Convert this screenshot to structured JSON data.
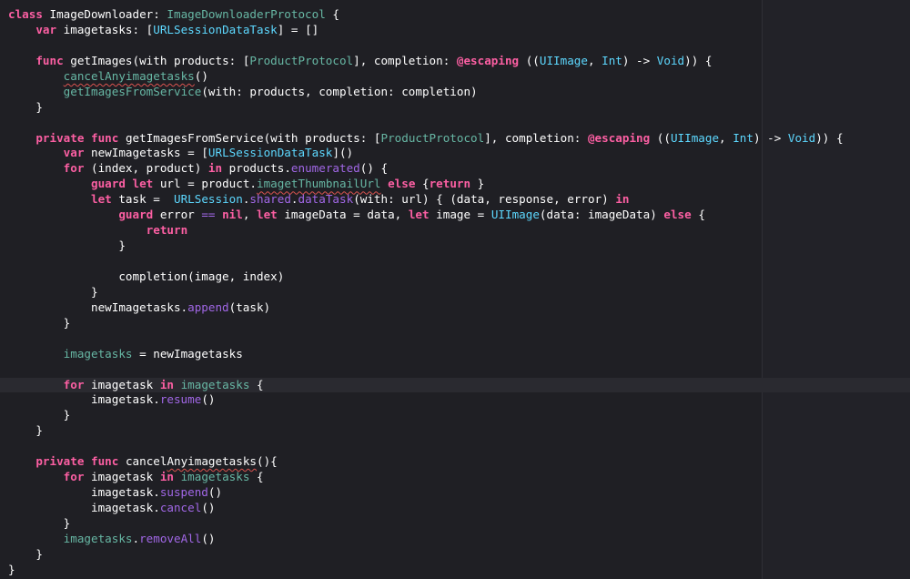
{
  "colors": {
    "background": "#1f1f24",
    "keyword": "#fc5fa3",
    "type": "#5dd8ff",
    "project_symbol": "#a167e6",
    "property": "#67b7a4",
    "plain": "#ffffff",
    "current_line": "#2a2a30"
  },
  "editor": {
    "current_line_index": 24,
    "lines": [
      {
        "tokens": [
          {
            "t": "class",
            "c": "kw"
          },
          {
            "t": " ImageDownloader: ",
            "c": "pl"
          },
          {
            "t": "ImageDownloaderProtocol",
            "c": "prm"
          },
          {
            "t": " {",
            "c": "pl"
          }
        ]
      },
      {
        "tokens": [
          {
            "t": "    ",
            "c": "pl"
          },
          {
            "t": "var",
            "c": "kw"
          },
          {
            "t": " imagetasks: [",
            "c": "pl"
          },
          {
            "t": "URLSessionDataTask",
            "c": "typ"
          },
          {
            "t": "] = []",
            "c": "pl"
          }
        ]
      },
      {
        "tokens": []
      },
      {
        "tokens": [
          {
            "t": "    ",
            "c": "pl"
          },
          {
            "t": "func",
            "c": "kw"
          },
          {
            "t": " getImages(with products: [",
            "c": "pl"
          },
          {
            "t": "ProductProtocol",
            "c": "prm"
          },
          {
            "t": "], completion: ",
            "c": "pl"
          },
          {
            "t": "@escaping",
            "c": "kw"
          },
          {
            "t": " ((",
            "c": "pl"
          },
          {
            "t": "UIImage",
            "c": "typ"
          },
          {
            "t": ", ",
            "c": "pl"
          },
          {
            "t": "Int",
            "c": "typ"
          },
          {
            "t": ") -> ",
            "c": "pl"
          },
          {
            "t": "Void",
            "c": "typ"
          },
          {
            "t": ")) {",
            "c": "pl"
          }
        ]
      },
      {
        "tokens": [
          {
            "t": "        ",
            "c": "pl"
          },
          {
            "t": "cancelAnyimagetasks",
            "c": "prm",
            "sq": true
          },
          {
            "t": "()",
            "c": "pl"
          }
        ]
      },
      {
        "tokens": [
          {
            "t": "        ",
            "c": "pl"
          },
          {
            "t": "getImagesFromService",
            "c": "prm"
          },
          {
            "t": "(with: products, completion: completion)",
            "c": "pl"
          }
        ]
      },
      {
        "tokens": [
          {
            "t": "    }",
            "c": "pl"
          }
        ]
      },
      {
        "tokens": []
      },
      {
        "tokens": [
          {
            "t": "    ",
            "c": "pl"
          },
          {
            "t": "private",
            "c": "kw"
          },
          {
            "t": " ",
            "c": "pl"
          },
          {
            "t": "func",
            "c": "kw"
          },
          {
            "t": " getImagesFromService(with products: [",
            "c": "pl"
          },
          {
            "t": "ProductProtocol",
            "c": "prm"
          },
          {
            "t": "], completion: ",
            "c": "pl"
          },
          {
            "t": "@escaping",
            "c": "kw"
          },
          {
            "t": " ((",
            "c": "pl"
          },
          {
            "t": "UIImage",
            "c": "typ"
          },
          {
            "t": ", ",
            "c": "pl"
          },
          {
            "t": "Int",
            "c": "typ"
          },
          {
            "t": ") -> ",
            "c": "pl"
          },
          {
            "t": "Void",
            "c": "typ"
          },
          {
            "t": ")) {",
            "c": "pl"
          }
        ]
      },
      {
        "tokens": [
          {
            "t": "        ",
            "c": "pl"
          },
          {
            "t": "var",
            "c": "kw"
          },
          {
            "t": " newImagetasks = [",
            "c": "pl"
          },
          {
            "t": "URLSessionDataTask",
            "c": "typ"
          },
          {
            "t": "]()",
            "c": "pl"
          }
        ]
      },
      {
        "tokens": [
          {
            "t": "        ",
            "c": "pl"
          },
          {
            "t": "for",
            "c": "kw"
          },
          {
            "t": " (index, product) ",
            "c": "pl"
          },
          {
            "t": "in",
            "c": "kw"
          },
          {
            "t": " products.",
            "c": "pl"
          },
          {
            "t": "enumerated",
            "c": "prj"
          },
          {
            "t": "() {",
            "c": "pl"
          }
        ]
      },
      {
        "tokens": [
          {
            "t": "            ",
            "c": "pl"
          },
          {
            "t": "guard",
            "c": "kw"
          },
          {
            "t": " ",
            "c": "pl"
          },
          {
            "t": "let",
            "c": "kw"
          },
          {
            "t": " url = product.",
            "c": "pl"
          },
          {
            "t": "imagetThumbnailUrl",
            "c": "prm",
            "sq": true
          },
          {
            "t": " ",
            "c": "pl"
          },
          {
            "t": "else",
            "c": "kw"
          },
          {
            "t": " {",
            "c": "pl"
          },
          {
            "t": "return",
            "c": "kw"
          },
          {
            "t": " }",
            "c": "pl"
          }
        ]
      },
      {
        "tokens": [
          {
            "t": "            ",
            "c": "pl"
          },
          {
            "t": "let",
            "c": "kw"
          },
          {
            "t": " task =  ",
            "c": "pl"
          },
          {
            "t": "URLSession",
            "c": "typ"
          },
          {
            "t": ".",
            "c": "pl"
          },
          {
            "t": "shared",
            "c": "prj"
          },
          {
            "t": ".",
            "c": "pl"
          },
          {
            "t": "dataTask",
            "c": "prj"
          },
          {
            "t": "(with: url) { (data, response, error) ",
            "c": "pl"
          },
          {
            "t": "in",
            "c": "kw"
          }
        ]
      },
      {
        "tokens": [
          {
            "t": "                ",
            "c": "pl"
          },
          {
            "t": "guard",
            "c": "kw"
          },
          {
            "t": " error ",
            "c": "pl"
          },
          {
            "t": "==",
            "c": "prj"
          },
          {
            "t": " ",
            "c": "pl"
          },
          {
            "t": "nil",
            "c": "kw"
          },
          {
            "t": ", ",
            "c": "pl"
          },
          {
            "t": "let",
            "c": "kw"
          },
          {
            "t": " imageData = data, ",
            "c": "pl"
          },
          {
            "t": "let",
            "c": "kw"
          },
          {
            "t": " image = ",
            "c": "pl"
          },
          {
            "t": "UIImage",
            "c": "typ"
          },
          {
            "t": "(data: imageData) ",
            "c": "pl"
          },
          {
            "t": "else",
            "c": "kw"
          },
          {
            "t": " {",
            "c": "pl"
          }
        ]
      },
      {
        "tokens": [
          {
            "t": "                    ",
            "c": "pl"
          },
          {
            "t": "return",
            "c": "kw"
          }
        ]
      },
      {
        "tokens": [
          {
            "t": "                }",
            "c": "pl"
          }
        ]
      },
      {
        "tokens": []
      },
      {
        "tokens": [
          {
            "t": "                completion(image, index)",
            "c": "pl"
          }
        ]
      },
      {
        "tokens": [
          {
            "t": "            }",
            "c": "pl"
          }
        ]
      },
      {
        "tokens": [
          {
            "t": "            newImagetasks.",
            "c": "pl"
          },
          {
            "t": "append",
            "c": "prj"
          },
          {
            "t": "(task)",
            "c": "pl"
          }
        ]
      },
      {
        "tokens": [
          {
            "t": "        }",
            "c": "pl"
          }
        ]
      },
      {
        "tokens": []
      },
      {
        "tokens": [
          {
            "t": "        ",
            "c": "pl"
          },
          {
            "t": "imagetasks",
            "c": "prm"
          },
          {
            "t": " = newImagetasks",
            "c": "pl"
          }
        ]
      },
      {
        "tokens": []
      },
      {
        "tokens": [
          {
            "t": "        ",
            "c": "pl"
          },
          {
            "t": "for",
            "c": "kw"
          },
          {
            "t": " imagetask ",
            "c": "pl"
          },
          {
            "t": "in",
            "c": "kw"
          },
          {
            "t": " ",
            "c": "pl"
          },
          {
            "t": "imagetasks",
            "c": "prm"
          },
          {
            "t": " {",
            "c": "pl"
          }
        ]
      },
      {
        "tokens": [
          {
            "t": "            imagetask.",
            "c": "pl"
          },
          {
            "t": "resume",
            "c": "prj"
          },
          {
            "t": "()",
            "c": "pl"
          }
        ]
      },
      {
        "tokens": [
          {
            "t": "        }",
            "c": "pl"
          }
        ]
      },
      {
        "tokens": [
          {
            "t": "    }",
            "c": "pl"
          }
        ]
      },
      {
        "tokens": []
      },
      {
        "tokens": [
          {
            "t": "    ",
            "c": "pl"
          },
          {
            "t": "private",
            "c": "kw"
          },
          {
            "t": " ",
            "c": "pl"
          },
          {
            "t": "func",
            "c": "kw"
          },
          {
            "t": " cancel",
            "c": "pl"
          },
          {
            "t": "Anyimagetasks",
            "c": "pl",
            "sq": true
          },
          {
            "t": "(){",
            "c": "pl"
          }
        ]
      },
      {
        "tokens": [
          {
            "t": "        ",
            "c": "pl"
          },
          {
            "t": "for",
            "c": "kw"
          },
          {
            "t": " imagetask ",
            "c": "pl"
          },
          {
            "t": "in",
            "c": "kw"
          },
          {
            "t": " ",
            "c": "pl"
          },
          {
            "t": "imagetasks",
            "c": "prm"
          },
          {
            "t": " {",
            "c": "pl"
          }
        ]
      },
      {
        "tokens": [
          {
            "t": "            imagetask.",
            "c": "pl"
          },
          {
            "t": "suspend",
            "c": "prj"
          },
          {
            "t": "()",
            "c": "pl"
          }
        ]
      },
      {
        "tokens": [
          {
            "t": "            imagetask.",
            "c": "pl"
          },
          {
            "t": "cancel",
            "c": "prj"
          },
          {
            "t": "()",
            "c": "pl"
          }
        ]
      },
      {
        "tokens": [
          {
            "t": "        }",
            "c": "pl"
          }
        ]
      },
      {
        "tokens": [
          {
            "t": "        ",
            "c": "pl"
          },
          {
            "t": "imagetasks",
            "c": "prm"
          },
          {
            "t": ".",
            "c": "pl"
          },
          {
            "t": "removeAll",
            "c": "prj"
          },
          {
            "t": "()",
            "c": "pl"
          }
        ]
      },
      {
        "tokens": [
          {
            "t": "    }",
            "c": "pl"
          }
        ]
      },
      {
        "tokens": [
          {
            "t": "}",
            "c": "pl"
          }
        ]
      }
    ]
  }
}
